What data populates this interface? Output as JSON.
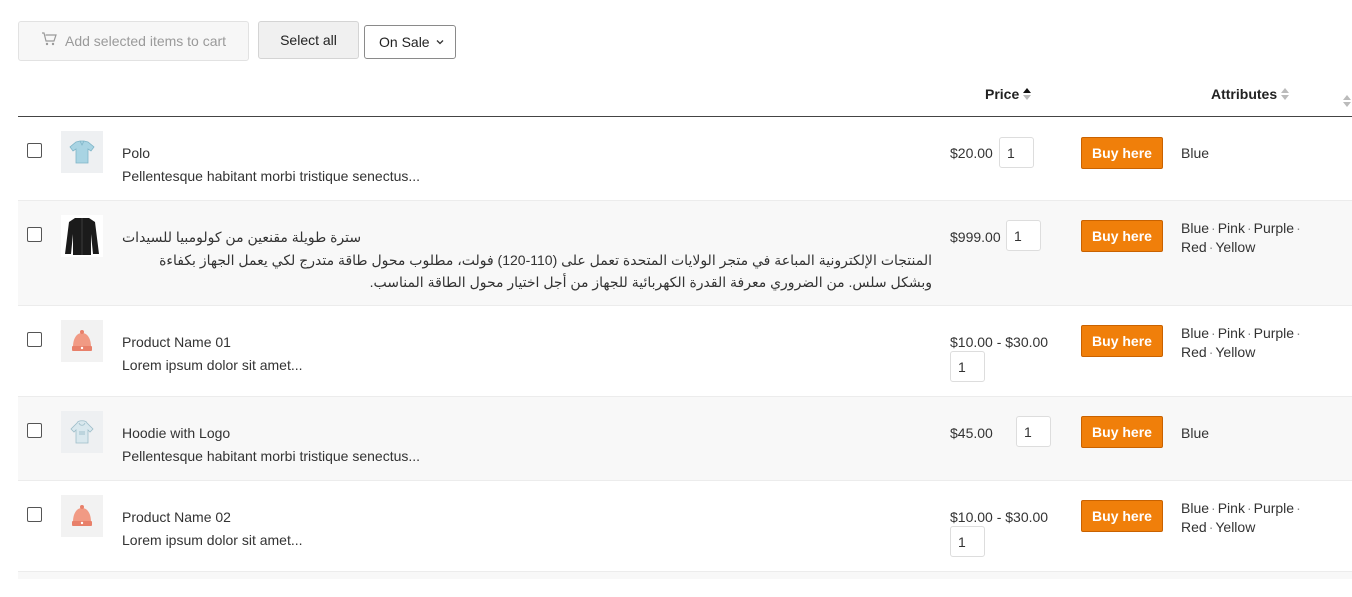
{
  "toolbar": {
    "cart_label": "Add selected items to cart",
    "select_all_label": "Select all",
    "filter_value": "On Sale"
  },
  "header": {
    "price_label": "Price",
    "attributes_label": "Attributes"
  },
  "buy_label": "Buy here",
  "rows": [
    {
      "name": "Polo",
      "desc": "Pellentesque habitant morbi tristique senectus...",
      "price": "$20.00",
      "qty": "1",
      "attrs_line1": [
        "Blue"
      ],
      "attrs_line2": [],
      "image": "polo-shirt"
    },
    {
      "name": "سترة طويلة مقنعين من كولومبيا للسيدات",
      "desc": "المنتجات الإلكترونية المباعة في متجر الولايات المتحدة تعمل على (110-120) فولت، مطلوب محول طاقة متدرج لكي يعمل الجهاز بكفاءة وبشكل سلس. من الضروري معرفة القدرة الكهربائية للجهاز من أجل اختيار محول الطاقة المناسب.",
      "price": "$999.00",
      "qty": "1",
      "attrs_line1": [
        "Blue",
        "Pink",
        "Purple"
      ],
      "attrs_line2": [
        "Red",
        "Yellow"
      ],
      "image": "black-jacket"
    },
    {
      "name": "Product Name 01",
      "desc": "Lorem ipsum dolor sit amet...",
      "price": "$10.00 - $30.00",
      "qty": "1",
      "attrs_line1": [
        "Blue",
        "Pink",
        "Purple"
      ],
      "attrs_line2": [
        "Red",
        "Yellow"
      ],
      "image": "beanie"
    },
    {
      "name": "Hoodie with Logo",
      "desc": "Pellentesque habitant morbi tristique senectus...",
      "price": "$45.00",
      "qty": "1",
      "attrs_line1": [
        "Blue"
      ],
      "attrs_line2": [],
      "image": "hoodie"
    },
    {
      "name": "Product Name 02",
      "desc": "Lorem ipsum dolor sit amet...",
      "price": "$10.00 - $30.00",
      "qty": "1",
      "attrs_line1": [
        "Blue",
        "Pink",
        "Purple"
      ],
      "attrs_line2": [
        "Red",
        "Yellow"
      ],
      "image": "beanie"
    }
  ],
  "colors": {
    "buy_button": "#f07f0a",
    "row_alt": "#f8f8f8"
  }
}
